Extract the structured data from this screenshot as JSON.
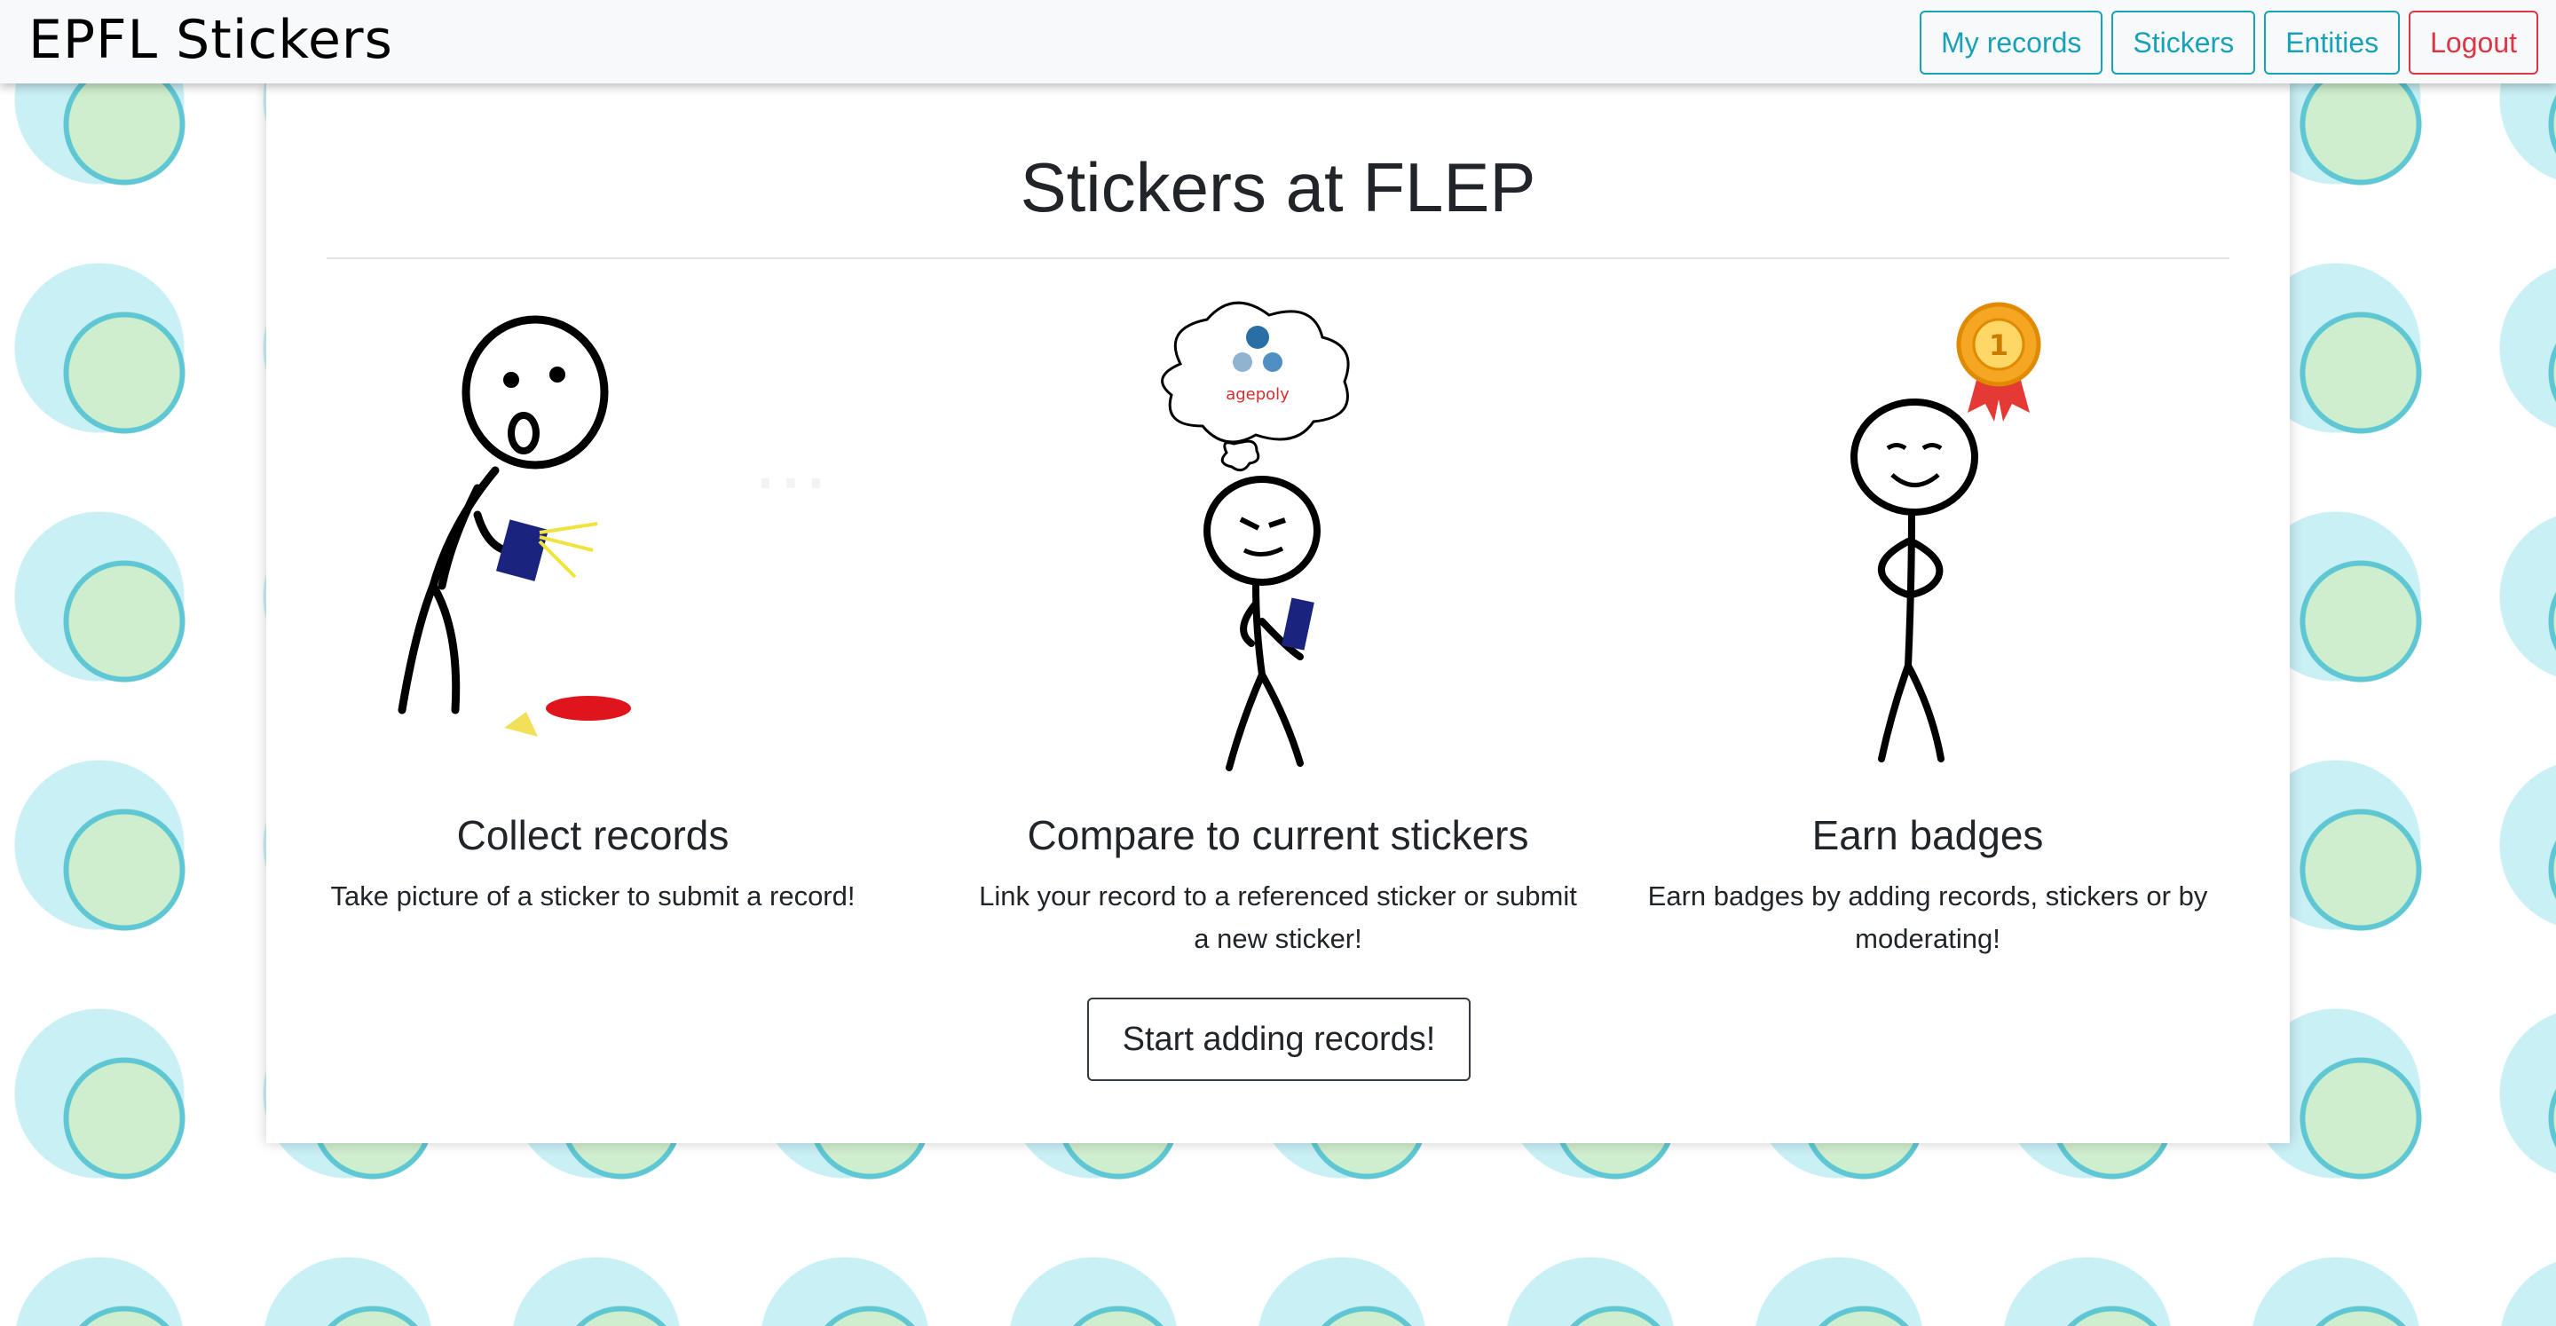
{
  "navbar": {
    "brand": "EPFL Stickers",
    "buttons": [
      {
        "label": "My records"
      },
      {
        "label": "Stickers"
      },
      {
        "label": "Entities"
      },
      {
        "label": "Logout"
      }
    ]
  },
  "main": {
    "title": "Stickers at FLEP",
    "features": [
      {
        "icon": "stickman-collecting-icon",
        "heading": "Collect records",
        "text": "Take picture of a sticker to submit a record!"
      },
      {
        "icon": "stickman-thinking-icon",
        "heading": "Compare to current stickers",
        "text": "Link your record to a referenced sticker or submit a new sticker!",
        "bubble_text": "agepoly"
      },
      {
        "icon": "stickman-badge-icon",
        "heading": "Earn badges",
        "text": "Earn badges by adding records, stickers or by moderating!",
        "badge_text": "1"
      }
    ],
    "cta_label": "Start adding records!"
  },
  "colors": {
    "info": "#17a2b8",
    "danger": "#dc3545",
    "dark": "#343a40",
    "background_sticker": "#cfeecd"
  }
}
